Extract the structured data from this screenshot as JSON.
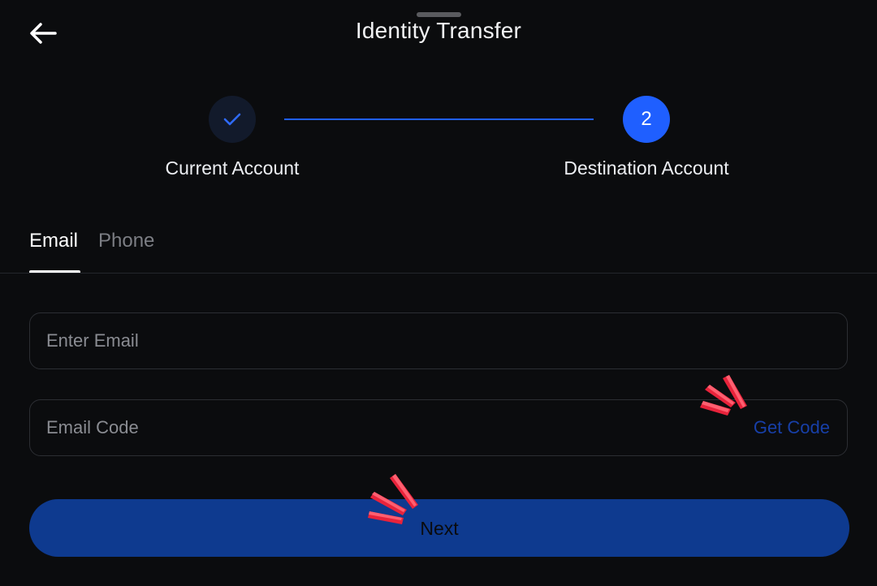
{
  "header": {
    "title": "Identity Transfer",
    "back_icon": "arrow-left-icon"
  },
  "steps": [
    {
      "label": "Current Account",
      "status": "completed",
      "icon": "check-icon"
    },
    {
      "label": "Destination Account",
      "number": "2",
      "status": "active"
    }
  ],
  "tabs": [
    {
      "label": "Email",
      "active": true
    },
    {
      "label": "Phone",
      "active": false
    }
  ],
  "form": {
    "email": {
      "value": "",
      "placeholder": "Enter Email"
    },
    "email_code": {
      "value": "",
      "placeholder": "Email Code"
    },
    "get_code_label": "Get Code",
    "next_label": "Next"
  },
  "colors": {
    "background": "#0b0c0e",
    "accent": "#1f5fff",
    "button": "#0e3a8f",
    "tap_marker": "#f0344a"
  }
}
